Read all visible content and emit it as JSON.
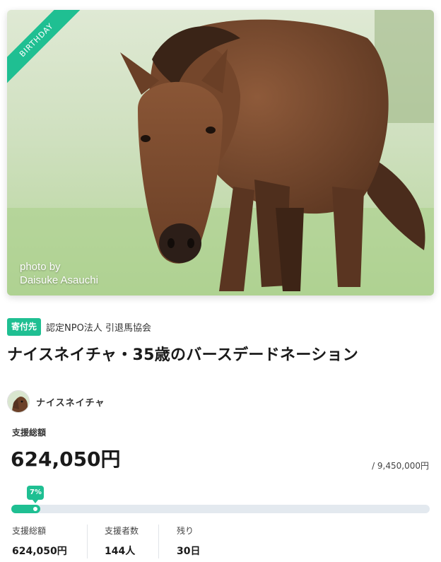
{
  "hero": {
    "ribbon": "BIRTHDAY",
    "credit_line1": "photo by",
    "credit_line2": "Daisuke Asauchi"
  },
  "beneficiary": {
    "tag": "寄付先",
    "org": "認定NPO法人 引退馬協会"
  },
  "project": {
    "title": "ナイスネイチャ・35歳のバースデードネーション",
    "owner": "ナイスネイチャ"
  },
  "funding": {
    "total_label": "支援総額",
    "total": "624,050円",
    "goal": "/ 9,450,000円",
    "percent_label": "7%",
    "percent": 7
  },
  "stats": [
    {
      "label": "支援総額",
      "value": "624,050円"
    },
    {
      "label": "支援者数",
      "value": "144人"
    },
    {
      "label": "残り",
      "value": "30日"
    }
  ],
  "colors": {
    "accent": "#1fbf92",
    "track": "#e3e9ef"
  }
}
